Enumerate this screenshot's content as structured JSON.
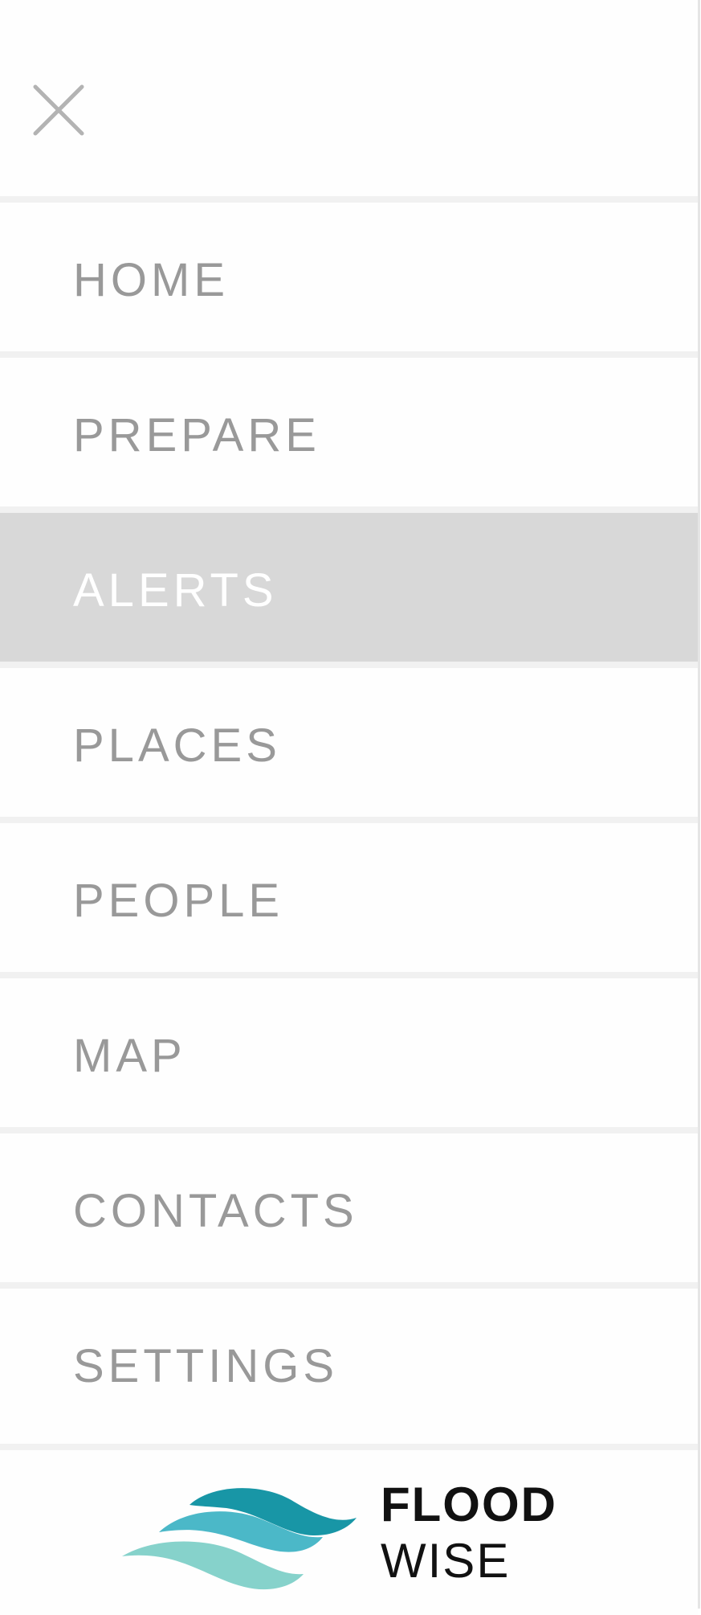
{
  "close": {
    "icon": "close-icon",
    "color": "#b3b3b3"
  },
  "menu": {
    "items": [
      {
        "label": "HOME",
        "active": false
      },
      {
        "label": "PREPARE",
        "active": false
      },
      {
        "label": "ALERTS",
        "active": true
      },
      {
        "label": "PLACES",
        "active": false
      },
      {
        "label": "PEOPLE",
        "active": false
      },
      {
        "label": "MAP",
        "active": false
      },
      {
        "label": "CONTACTS",
        "active": false
      },
      {
        "label": "SETTINGS",
        "active": false
      }
    ],
    "text_color": "#999999",
    "active_background": "#d8d8d8",
    "active_text_color": "#ffffff"
  },
  "logo": {
    "icon": "wave-logo-icon",
    "line1": "FLOOD",
    "line2": "WISE",
    "colors": [
      "#1896a6",
      "#4bb8c8",
      "#86d2cb"
    ]
  }
}
